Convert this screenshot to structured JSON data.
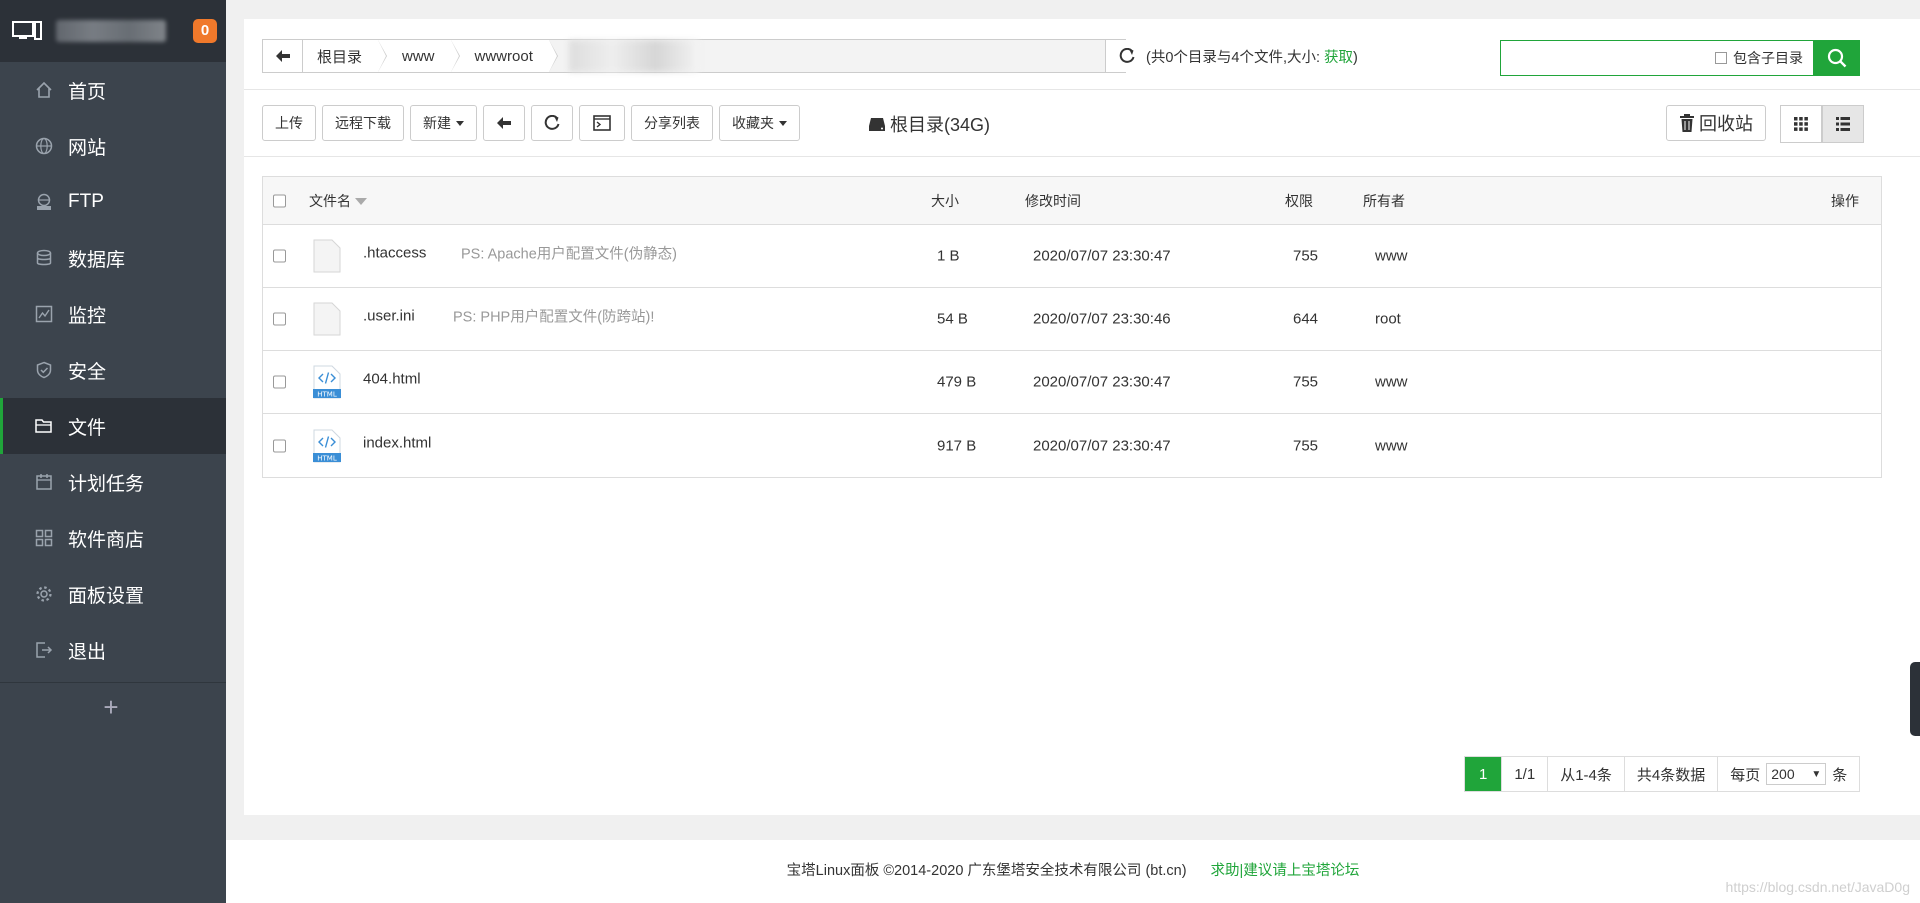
{
  "sidebar": {
    "badge": "0",
    "items": [
      {
        "label": "首页",
        "icon": "home-icon"
      },
      {
        "label": "网站",
        "icon": "globe-icon"
      },
      {
        "label": "FTP",
        "icon": "ftp-icon"
      },
      {
        "label": "数据库",
        "icon": "database-icon"
      },
      {
        "label": "监控",
        "icon": "monitor-chart-icon"
      },
      {
        "label": "安全",
        "icon": "shield-icon"
      },
      {
        "label": "文件",
        "icon": "folder-icon",
        "active": true
      },
      {
        "label": "计划任务",
        "icon": "calendar-icon"
      },
      {
        "label": "软件商店",
        "icon": "apps-grid-icon"
      },
      {
        "label": "面板设置",
        "icon": "gear-icon"
      },
      {
        "label": "退出",
        "icon": "logout-icon"
      }
    ],
    "add": "+"
  },
  "breadcrumb": [
    "根目录",
    "www",
    "wwwroot"
  ],
  "dir_info": {
    "prefix": "(共0个目录与4个文件,大小: ",
    "link": "获取",
    "suffix": ")"
  },
  "search": {
    "placeholder": "",
    "subdir_label": "包含子目录"
  },
  "toolbar": {
    "upload": "上传",
    "remote_download": "远程下载",
    "new": "新建",
    "share_list": "分享列表",
    "favorites": "收藏夹"
  },
  "disk_label": "根目录(34G)",
  "recycle_label": "回收站",
  "table": {
    "headers": {
      "name": "文件名",
      "size": "大小",
      "mtime": "修改时间",
      "perm": "权限",
      "owner": "所有者",
      "action": "操作"
    },
    "rows": [
      {
        "name": ".htaccess",
        "ps": "PS: Apache用户配置文件(伪静态)",
        "size": "1 B",
        "mtime": "2020/07/07 23:30:47",
        "perm": "755",
        "owner": "www",
        "type": "file"
      },
      {
        "name": ".user.ini",
        "ps": "PS: PHP用户配置文件(防跨站)!",
        "size": "54 B",
        "mtime": "2020/07/07 23:30:46",
        "perm": "644",
        "owner": "root",
        "type": "file"
      },
      {
        "name": "404.html",
        "ps": "",
        "size": "479 B",
        "mtime": "2020/07/07 23:30:47",
        "perm": "755",
        "owner": "www",
        "type": "html"
      },
      {
        "name": "index.html",
        "ps": "",
        "size": "917 B",
        "mtime": "2020/07/07 23:30:47",
        "perm": "755",
        "owner": "www",
        "type": "html"
      }
    ]
  },
  "pager": {
    "current": "1",
    "pages": "1/1",
    "range": "从1-4条",
    "total": "共4条数据",
    "per_page_label": "每页",
    "per_page": "200",
    "unit": "条"
  },
  "footer": {
    "copyright": "宝塔Linux面板 ©2014-2020 广东堡塔安全技术有限公司 (bt.cn)",
    "help": "求助|建议请上宝塔论坛"
  },
  "watermark": "https://blog.csdn.net/JavaD0g",
  "colors": {
    "accent": "#20a53a",
    "sidebar": "#3c444d",
    "badge": "#f0792b"
  }
}
